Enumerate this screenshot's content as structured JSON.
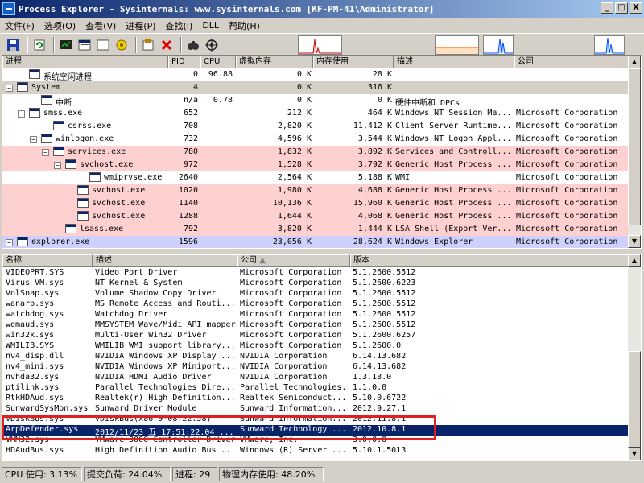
{
  "window": {
    "title": "Process Explorer - Sysinternals: www.sysinternals.com [KF-PM-41\\Administrator]",
    "btn_min": "_",
    "btn_max": "□",
    "btn_close": "X"
  },
  "menu": [
    "文件(F)",
    "选项(O)",
    "查看(V)",
    "进程(P)",
    "查找(I)",
    "DLL",
    "帮助(H)"
  ],
  "process_columns": [
    "进程",
    "PID",
    "CPU",
    "虚拟内存",
    "内存使用",
    "描述",
    "公司"
  ],
  "processes": [
    {
      "name": "系统空闲进程",
      "pid": "0",
      "cpu": "96.88",
      "vm": "0 K",
      "mem": "28 K",
      "desc": "",
      "company": "",
      "indent": 1,
      "bg": "#ffffff",
      "box": ""
    },
    {
      "name": "System",
      "pid": "4",
      "cpu": "",
      "vm": "0 K",
      "mem": "316 K",
      "desc": "",
      "company": "",
      "indent": 0,
      "bg": "#d4d0c8",
      "box": "−"
    },
    {
      "name": "中断",
      "pid": "n/a",
      "cpu": "0.78",
      "vm": "0 K",
      "mem": "0 K",
      "desc": "硬件中断和 DPCs",
      "company": "",
      "indent": 2,
      "bg": "#ffffff",
      "box": ""
    },
    {
      "name": "smss.exe",
      "pid": "652",
      "cpu": "",
      "vm": "212 K",
      "mem": "464 K",
      "desc": "Windows NT Session Ma...",
      "company": "Microsoft Corporation",
      "indent": 1,
      "bg": "#ffffff",
      "box": "−"
    },
    {
      "name": "csrss.exe",
      "pid": "708",
      "cpu": "",
      "vm": "2,820 K",
      "mem": "11,412 K",
      "desc": "Client Server Runtime...",
      "company": "Microsoft Corporation",
      "indent": 3,
      "bg": "#ffffff",
      "box": ""
    },
    {
      "name": "winlogon.exe",
      "pid": "732",
      "cpu": "",
      "vm": "4,596 K",
      "mem": "3,544 K",
      "desc": "Windows NT Logon Appl...",
      "company": "Microsoft Corporation",
      "indent": 2,
      "bg": "#ffffff",
      "box": "−"
    },
    {
      "name": "services.exe",
      "pid": "780",
      "cpu": "",
      "vm": "1,832 K",
      "mem": "3,892 K",
      "desc": "Services and Controll...",
      "company": "Microsoft Corporation",
      "indent": 3,
      "bg": "#ffd0d0",
      "box": "−"
    },
    {
      "name": "svchost.exe",
      "pid": "972",
      "cpu": "",
      "vm": "1,528 K",
      "mem": "3,792 K",
      "desc": "Generic Host Process ...",
      "company": "Microsoft Corporation",
      "indent": 4,
      "bg": "#ffd0d0",
      "box": "−"
    },
    {
      "name": "wmiprvse.exe",
      "pid": "2640",
      "cpu": "",
      "vm": "2,564 K",
      "mem": "5,188 K",
      "desc": "WMI",
      "company": "Microsoft Corporation",
      "indent": 6,
      "bg": "#ffffff",
      "box": ""
    },
    {
      "name": "svchost.exe",
      "pid": "1020",
      "cpu": "",
      "vm": "1,980 K",
      "mem": "4,688 K",
      "desc": "Generic Host Process ...",
      "company": "Microsoft Corporation",
      "indent": 5,
      "bg": "#ffd0d0",
      "box": ""
    },
    {
      "name": "svchost.exe",
      "pid": "1140",
      "cpu": "",
      "vm": "10,136 K",
      "mem": "15,960 K",
      "desc": "Generic Host Process ...",
      "company": "Microsoft Corporation",
      "indent": 5,
      "bg": "#ffd0d0",
      "box": ""
    },
    {
      "name": "svchost.exe",
      "pid": "1288",
      "cpu": "",
      "vm": "1,644 K",
      "mem": "4,068 K",
      "desc": "Generic Host Process ...",
      "company": "Microsoft Corporation",
      "indent": 5,
      "bg": "#ffd0d0",
      "box": ""
    },
    {
      "name": "lsass.exe",
      "pid": "792",
      "cpu": "",
      "vm": "3,820 K",
      "mem": "1,444 K",
      "desc": "LSA Shell (Export Ver...",
      "company": "Microsoft Corporation",
      "indent": 4,
      "bg": "#ffd0d0",
      "box": ""
    },
    {
      "name": "explorer.exe",
      "pid": "1596",
      "cpu": "",
      "vm": "23,056 K",
      "mem": "28,624 K",
      "desc": "Windows Explorer",
      "company": "Microsoft Corporation",
      "indent": 0,
      "bg": "#d0d0ff",
      "box": "−"
    }
  ],
  "dll_columns": [
    "名称",
    "描述",
    "公司",
    "版本"
  ],
  "dll_sort_arrow": "▲",
  "dlls": [
    {
      "name": "VIDEOPRT.SYS",
      "desc": "Video Port Driver",
      "company": "Microsoft Corporation",
      "version": "5.1.2600.5512"
    },
    {
      "name": "Virus_VM.sys",
      "desc": "NT Kernel & System",
      "company": "Microsoft Corporation",
      "version": "5.1.2600.6223"
    },
    {
      "name": "VolSnap.sys",
      "desc": "Volume Shadow Copy Driver",
      "company": "Microsoft Corporation",
      "version": "5.1.2600.5512"
    },
    {
      "name": "wanarp.sys",
      "desc": "MS Remote Access and Routi...",
      "company": "Microsoft Corporation",
      "version": "5.1.2600.5512"
    },
    {
      "name": "watchdog.sys",
      "desc": "Watchdog Driver",
      "company": "Microsoft Corporation",
      "version": "5.1.2600.5512"
    },
    {
      "name": "wdmaud.sys",
      "desc": "MMSYSTEM Wave/Midi API mapper",
      "company": "Microsoft Corporation",
      "version": "5.1.2600.5512"
    },
    {
      "name": "win32k.sys",
      "desc": "Multi-User Win32 Driver",
      "company": "Microsoft Corporation",
      "version": "5.1.2600.6257"
    },
    {
      "name": "WMILIB.SYS",
      "desc": "WMILIB WMI support library...",
      "company": "Microsoft Corporation",
      "version": "5.1.2600.0"
    },
    {
      "name": "nv4_disp.dll",
      "desc": "NVIDIA Windows XP Display ...",
      "company": "NVIDIA Corporation",
      "version": "6.14.13.682"
    },
    {
      "name": "nv4_mini.sys",
      "desc": "NVIDIA Windows XP Miniport...",
      "company": "NVIDIA Corporation",
      "version": "6.14.13.682"
    },
    {
      "name": "nvhda32.sys",
      "desc": "NVIDIA HDMI Audio Driver",
      "company": "NVIDIA Corporation",
      "version": "1.3.18.0"
    },
    {
      "name": "ptilink.sys",
      "desc": "Parallel Technologies Dire...",
      "company": "Parallel Technologies...",
      "version": "1.1.0.0"
    },
    {
      "name": "RtkHDAud.sys",
      "desc": "Realtek(r) High Definition...",
      "company": "Realtek Semiconduct...",
      "version": "5.10.0.6722"
    },
    {
      "name": "SunwardSysMon.sys",
      "desc": "Sunward Driver Module",
      "company": "Sunward Information...",
      "version": "2012.9.27.1"
    },
    {
      "name": "VDiskBus.sys",
      "desc": "VDiskBus(x86 9-08:22.58)",
      "company": "Sunward Information...",
      "version": "2012.11.8.1"
    },
    {
      "name": "ArpDefender.sys",
      "desc": "2012/11/23 五 17:51:22.04 ...",
      "company": "Sunward Technology ...",
      "version": "2012.10.8.1"
    },
    {
      "name": "VMM32.sys",
      "desc": "VMware 3000 Controller Driver",
      "company": "VMware, Inc.",
      "version": "3.0.0.0"
    },
    {
      "name": "HDAudBus.sys",
      "desc": "High Definition Audio Bus ...",
      "company": "Windows (R) Server ...",
      "version": "5.10.1.5013"
    }
  ],
  "selected_dll_index": 15,
  "status": {
    "cpu": "CPU 使用: 3.13%",
    "commit": "提交负荷: 24.04%",
    "processes": "进程: 29",
    "physical": "物理内存使用: 48.20%"
  },
  "colors": {
    "selection": "#0a246a",
    "service_row": "#ffd0d0",
    "own_process_row": "#d0d0ff",
    "annotation_box": "#e02020",
    "graph_cpu": "#0050ff",
    "graph_commit": "#ff6000",
    "graph_io": "#c00000"
  }
}
